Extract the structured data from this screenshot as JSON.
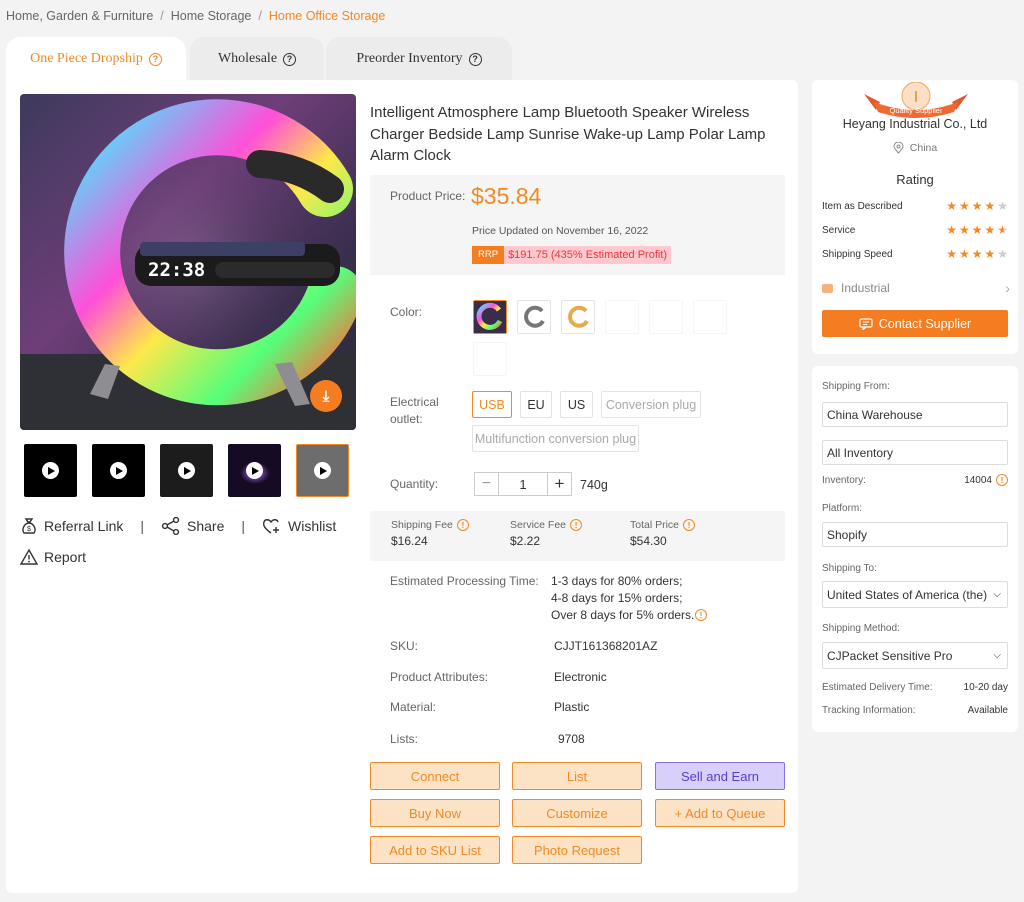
{
  "breadcrumb": [
    "Home, Garden & Furniture",
    "Home Storage",
    "Home Office Storage"
  ],
  "tabs": [
    {
      "label": "One Piece Dropship"
    },
    {
      "label": "Wholesale"
    },
    {
      "label": "Preorder Inventory"
    }
  ],
  "product": {
    "title": "Intelligent Atmosphere Lamp Bluetooth Speaker Wireless Charger Bedside Lamp Sunrise Wake-up Lamp Polar Lamp Alarm Clock",
    "clock_display": "22:38",
    "price_label": "Product Price:",
    "price": "$35.84",
    "price_updated": "Price Updated on November 16, 2022",
    "rrp_tag": "RRP",
    "rrp_value": "$191.75 (435% Estimated Profit)",
    "color_label": "Color:",
    "outlet_label": "Electrical outlet:",
    "outlets": [
      "USB",
      "EU",
      "US",
      "Conversion plug",
      "Multifunction conversion plug"
    ],
    "quantity_label": "Quantity:",
    "quantity": "1",
    "weight": "740g",
    "fees": [
      {
        "label": "Shipping Fee",
        "value": "$16.24"
      },
      {
        "label": "Service Fee",
        "value": "$2.22"
      },
      {
        "label": "Total Price",
        "value": "$54.30"
      }
    ],
    "processing_label": "Estimated Processing Time:",
    "processing": [
      "1-3 days for 80% orders;",
      "4-8 days for 15% orders;",
      "Over 8 days for 5% orders."
    ],
    "sku_label": "SKU:",
    "sku": "CJJT161368201AZ",
    "attr_label": "Product Attributes:",
    "attr": "Electronic",
    "material_label": "Material:",
    "material": "Plastic",
    "lists_label": "Lists:",
    "lists": "9708"
  },
  "buttons": {
    "connect": "Connect",
    "list": "List",
    "sell": "Sell and Earn",
    "buy": "Buy Now",
    "customize": "Customize",
    "queue": "+ Add to Queue",
    "sku_list": "Add to SKU List",
    "photo": "Photo Request"
  },
  "actions": {
    "referral": "Referral Link",
    "share": "Share",
    "wishlist": "Wishlist",
    "report": "Report",
    "separator": "|"
  },
  "supplier": {
    "badge_letter": "I",
    "badge_text": "Quality Supplier",
    "name": "Heyang Industrial Co., Ltd",
    "location": "China",
    "rating_title": "Rating",
    "ratings": [
      {
        "label": "Item as Described",
        "stars": 4
      },
      {
        "label": "Service",
        "stars": 4.5
      },
      {
        "label": "Shipping Speed",
        "stars": 4
      }
    ],
    "category": "Industrial",
    "contact": "Contact Supplier"
  },
  "shipping": {
    "from_label": "Shipping From:",
    "from": "China Warehouse",
    "inventory_select": "All Inventory",
    "inventory_label": "Inventory:",
    "inventory": "14004",
    "platform_label": "Platform:",
    "platform": "Shopify",
    "to_label": "Shipping To:",
    "to": "United States of America (the)",
    "method_label": "Shipping Method:",
    "method": "CJPacket Sensitive Pro",
    "delivery_label": "Estimated Delivery Time:",
    "delivery": "10-20 day",
    "tracking_label": "Tracking Information:",
    "tracking": "Available"
  },
  "colors": {
    "accent": "#f08a24",
    "accent_fill": "#f37d20",
    "purple": "#8a6ee8"
  }
}
